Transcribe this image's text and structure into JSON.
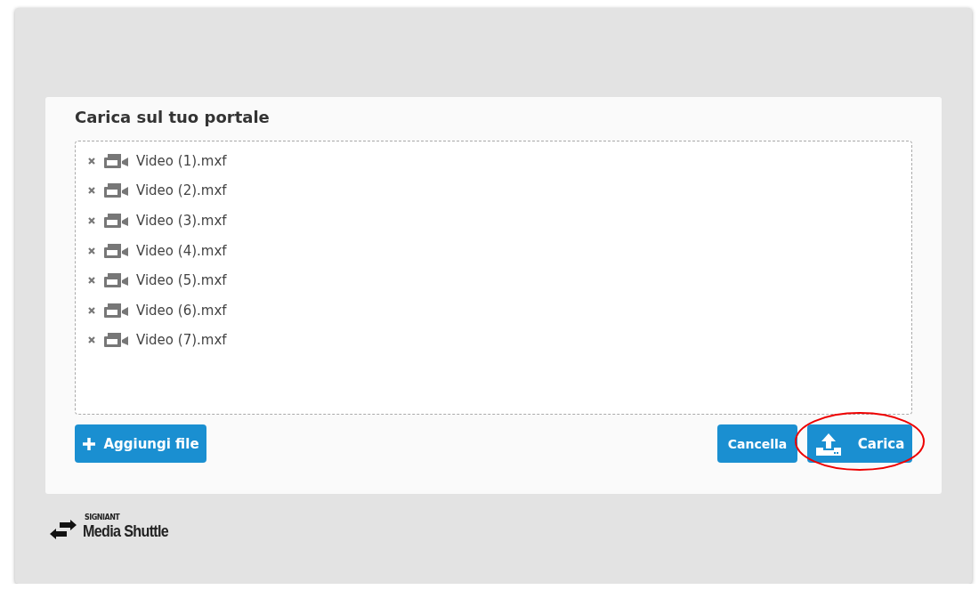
{
  "dialog": {
    "title": "Carica sul tuo portale"
  },
  "files": [
    {
      "name": "Video (1).mxf"
    },
    {
      "name": "Video (2).mxf"
    },
    {
      "name": "Video (3).mxf"
    },
    {
      "name": "Video (4).mxf"
    },
    {
      "name": "Video (5).mxf"
    },
    {
      "name": "Video (6).mxf"
    },
    {
      "name": "Video (7).mxf"
    }
  ],
  "buttons": {
    "add": "Aggiungi file",
    "cancel": "Cancella",
    "upload": "Carica"
  },
  "logo": {
    "brand": "SIGNIANT",
    "product": "Media Shuttle"
  }
}
